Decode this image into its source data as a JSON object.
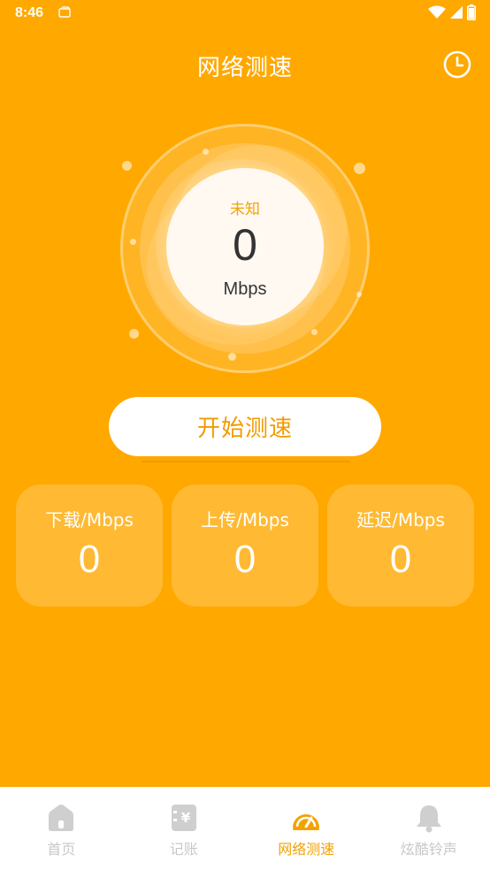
{
  "status_bar": {
    "time": "8:46"
  },
  "header": {
    "title": "网络测速"
  },
  "gauge": {
    "status": "未知",
    "value": "0",
    "unit": "Mbps"
  },
  "start_button": {
    "label": "开始测速"
  },
  "stats": [
    {
      "label": "下载/Mbps",
      "value": "0"
    },
    {
      "label": "上传/Mbps",
      "value": "0"
    },
    {
      "label": "延迟/Mbps",
      "value": "0"
    }
  ],
  "tabs": [
    {
      "label": "首页",
      "icon": "home-icon",
      "active": false
    },
    {
      "label": "记账",
      "icon": "ledger-icon",
      "active": false
    },
    {
      "label": "网络测速",
      "icon": "speedometer-icon",
      "active": true
    },
    {
      "label": "炫酷铃声",
      "icon": "bell-icon",
      "active": false
    }
  ],
  "colors": {
    "background": "#FFA800",
    "accent": "#F4A200",
    "tab_inactive": "#C8C8C8"
  }
}
